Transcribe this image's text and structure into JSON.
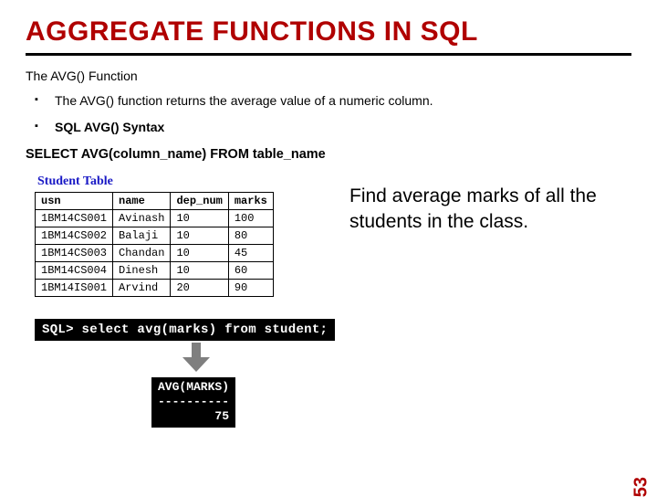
{
  "slide": {
    "title": "AGGREGATE FUNCTIONS IN SQL",
    "subheading": "The AVG() Function",
    "bullets": [
      "The AVG() function returns the average value of a numeric column.",
      "SQL AVG() Syntax"
    ],
    "bullet_bold_flags": [
      false,
      true
    ],
    "syntax": "SELECT AVG(column_name) FROM table_name",
    "table": {
      "caption": "Student Table",
      "headers": [
        "usn",
        "name",
        "dep_num",
        "marks"
      ],
      "rows": [
        [
          "1BM14CS001",
          "Avinash",
          "10",
          "100"
        ],
        [
          "1BM14CS002",
          "Balaji",
          "10",
          "80"
        ],
        [
          "1BM14CS003",
          "Chandan",
          "10",
          "45"
        ],
        [
          "1BM14CS004",
          "Dinesh",
          "10",
          "60"
        ],
        [
          "1BM14IS001",
          "Arvind",
          "20",
          "90"
        ]
      ]
    },
    "question": "Find average marks of all the students in the class.",
    "sql_prompt": "SQL>",
    "sql_query": "select avg(marks) from student;",
    "result": {
      "column": "AVG(MARKS)",
      "divider": "----------",
      "value": "75"
    },
    "page_number": "53"
  },
  "chart_data": {
    "type": "table",
    "title": "Student Table",
    "columns": [
      "usn",
      "name",
      "dep_num",
      "marks"
    ],
    "rows": [
      [
        "1BM14CS001",
        "Avinash",
        10,
        100
      ],
      [
        "1BM14CS002",
        "Balaji",
        10,
        80
      ],
      [
        "1BM14CS003",
        "Chandan",
        10,
        45
      ],
      [
        "1BM14CS004",
        "Dinesh",
        10,
        60
      ],
      [
        "1BM14IS001",
        "Arvind",
        20,
        90
      ]
    ],
    "aggregate": {
      "function": "AVG",
      "column": "marks",
      "result": 75
    }
  }
}
